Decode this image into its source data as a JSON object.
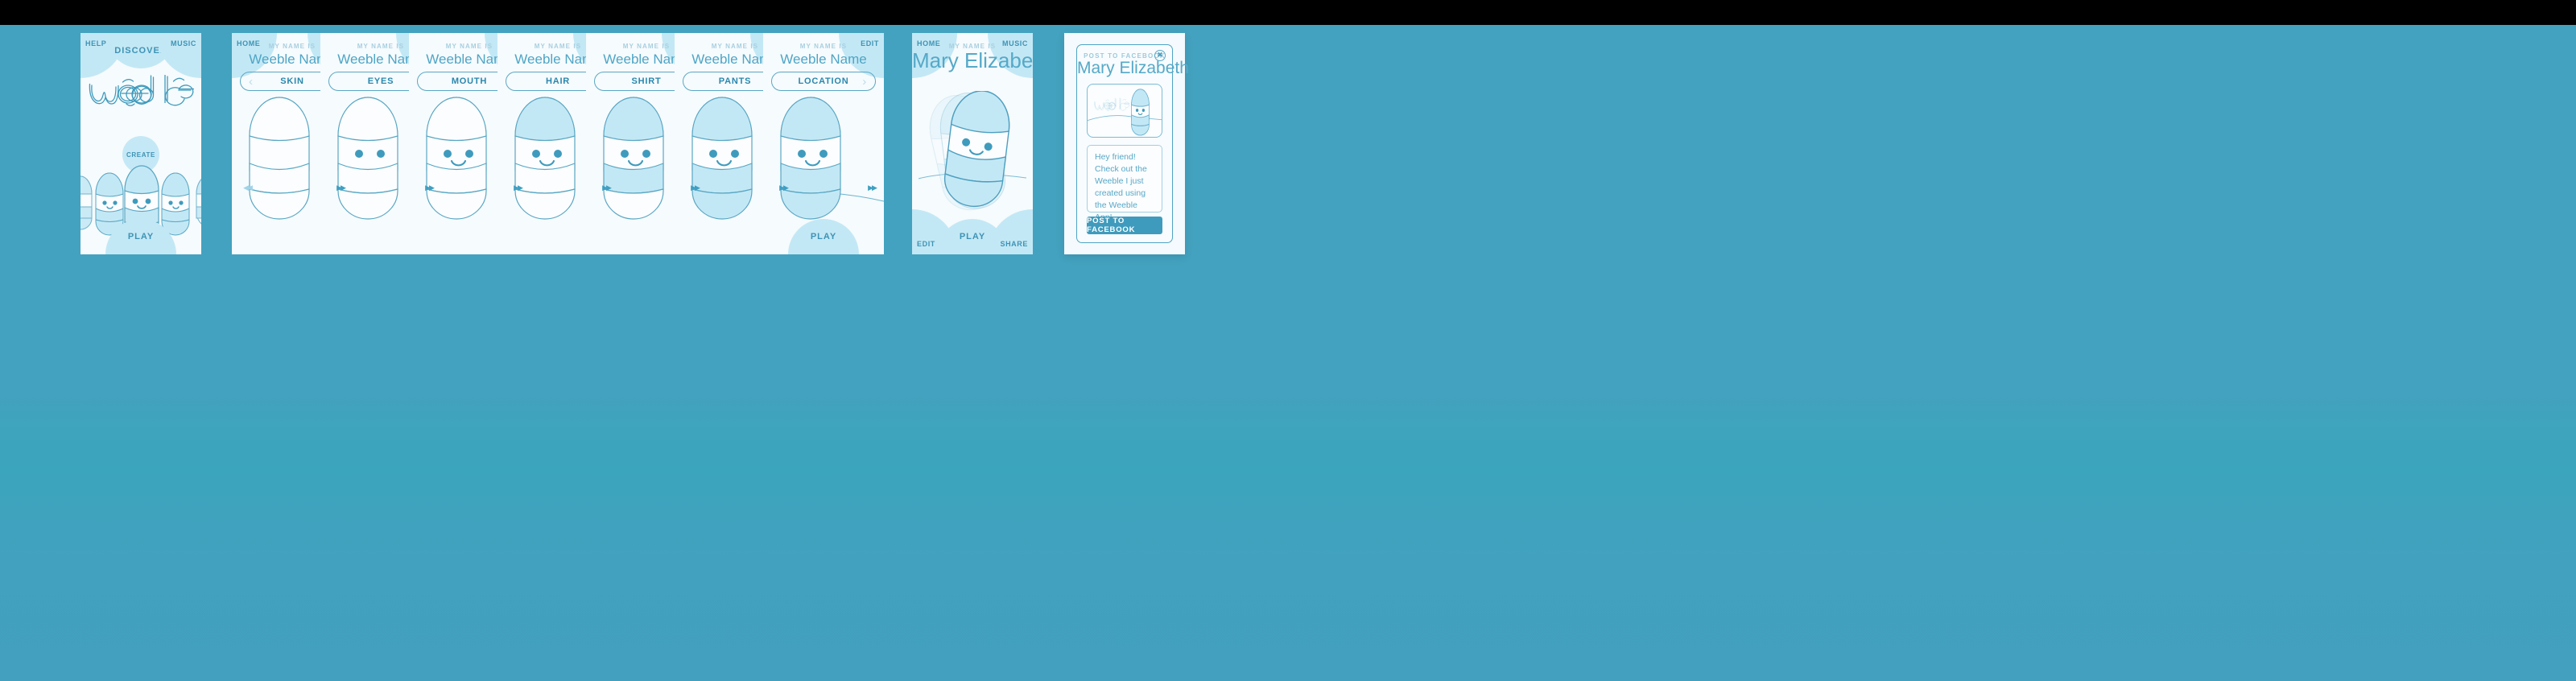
{
  "app": {
    "title": "Weebles",
    "accent": "#3f9bbd",
    "background": "#43a2bf",
    "panel_bg": "#f6fbfd",
    "light_blue": "#c3e8f5",
    "stroke_blue": "#5aa7c4"
  },
  "home_screen": {
    "help_label": "HELP",
    "discover_label": "DISCOVER",
    "music_label": "MUSIC",
    "logo_text": "Weebles",
    "create_label": "CREATE",
    "play_label": "PLAY"
  },
  "editor": {
    "home_label": "HOME",
    "edit_label": "EDIT",
    "name_caption": "MY NAME IS",
    "name_value": "Weeble Name",
    "prev_icon": "chevron-left",
    "next_icon": "chevron-right",
    "forward_icon": "fast-forward",
    "back_icon": "fast-backward",
    "play_label": "PLAY",
    "steps": [
      {
        "label": "SKIN",
        "hair": false,
        "eyes": false,
        "mouth": false,
        "shirt": false,
        "pants": false,
        "scene": false
      },
      {
        "label": "EYES",
        "hair": false,
        "eyes": true,
        "mouth": false,
        "shirt": false,
        "pants": false,
        "scene": false
      },
      {
        "label": "MOUTH",
        "hair": false,
        "eyes": true,
        "mouth": true,
        "shirt": false,
        "pants": false,
        "scene": false
      },
      {
        "label": "HAIR",
        "hair": true,
        "eyes": true,
        "mouth": true,
        "shirt": false,
        "pants": false,
        "scene": false
      },
      {
        "label": "SHIRT",
        "hair": true,
        "eyes": true,
        "mouth": true,
        "shirt": true,
        "pants": false,
        "scene": false
      },
      {
        "label": "PANTS",
        "hair": true,
        "eyes": true,
        "mouth": true,
        "shirt": true,
        "pants": true,
        "scene": false
      },
      {
        "label": "LOCATION",
        "hair": true,
        "eyes": true,
        "mouth": true,
        "shirt": true,
        "pants": true,
        "scene": true
      }
    ]
  },
  "play_screen": {
    "home_label": "HOME",
    "music_label": "MUSIC",
    "name_caption": "MY NAME IS",
    "name_value": "Mary Elizabeth",
    "edit_label": "EDIT",
    "play_label": "PLAY",
    "share_label": "SHARE"
  },
  "share_modal": {
    "header": "POST TO FACEBOOK",
    "close_icon": "close-icon",
    "name_value": "Mary Elizabeth",
    "preview_logo": "Weebles",
    "message": "Hey friend! Check out the Weeble I just created using the Weeble App!",
    "post_button": "POST TO FACEBOOK"
  }
}
